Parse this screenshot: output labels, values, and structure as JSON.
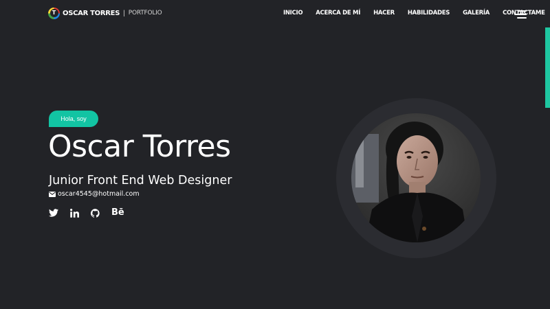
{
  "header": {
    "logo_letter": "T",
    "brand_name": "OSCAR TORRES",
    "brand_separator": "|",
    "brand_sub": "PORTFOLIO",
    "nav": [
      {
        "label": "INICIO"
      },
      {
        "label": "ACERCA DE MÍ"
      },
      {
        "label": "HACER"
      },
      {
        "label": "HABILIDADES"
      },
      {
        "label": "GALERÍA"
      },
      {
        "label": "CONTACTAME"
      }
    ],
    "menu_icon": "hamburger-menu-icon"
  },
  "hero": {
    "greeting": "Hola, soy",
    "name": "Oscar Torres",
    "role": "Junior Front End Web Designer",
    "email": "oscar4545@hotmail.com",
    "email_icon": "envelope-icon",
    "socials": [
      {
        "icon": "twitter-icon"
      },
      {
        "icon": "linkedin-icon"
      },
      {
        "icon": "github-icon"
      },
      {
        "icon": "behance-icon",
        "glyph": "Bē"
      }
    ],
    "portrait": "profile-photo"
  },
  "colors": {
    "background": "#222327",
    "accent": "#12c4a3",
    "text": "#ffffff",
    "portrait_ring": "#2b2c31"
  }
}
